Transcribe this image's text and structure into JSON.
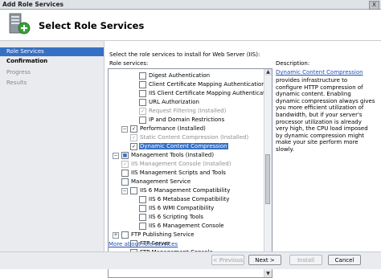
{
  "window": {
    "title": "Add Role Services",
    "close_glyph": "X"
  },
  "header": {
    "title": "Select Role Services"
  },
  "nav": [
    {
      "label": "Role Services",
      "state": "active"
    },
    {
      "label": "Confirmation",
      "state": "current"
    },
    {
      "label": "Progress",
      "state": "disabled"
    },
    {
      "label": "Results",
      "state": "disabled"
    }
  ],
  "instructions": "Select the role services to install for Web Server (IIS):",
  "role_services_label": "Role services:",
  "tree": [
    {
      "label": "Digest Authentication",
      "check": "",
      "style": "normal"
    },
    {
      "label": "Client Certificate Mapping Authentication",
      "check": "",
      "style": "normal"
    },
    {
      "label": "IIS Client Certificate Mapping Authentication",
      "check": "",
      "style": "normal"
    },
    {
      "label": "URL Authorization",
      "check": "",
      "style": "normal"
    },
    {
      "label": "Request Filtering  (Installed)",
      "check": "✓",
      "style": "gray"
    },
    {
      "label": "IP and Domain Restrictions",
      "check": "",
      "style": "normal"
    },
    {
      "label": "Performance  (Installed)",
      "check": "✓",
      "style": "normal"
    },
    {
      "label": "Static Content Compression  (Installed)",
      "check": "✓",
      "style": "gray"
    },
    {
      "label": "Dynamic Content Compression",
      "check": "✓",
      "style": "selected"
    },
    {
      "label": "Management Tools  (Installed)",
      "check": "■",
      "style": "normal"
    },
    {
      "label": "IIS Management Console  (Installed)",
      "check": "✓",
      "style": "gray"
    },
    {
      "label": "IIS Management Scripts and Tools",
      "check": "",
      "style": "normal"
    },
    {
      "label": "Management Service",
      "check": "",
      "style": "normal"
    },
    {
      "label": "IIS 6 Management Compatibility",
      "check": "",
      "style": "normal"
    },
    {
      "label": "IIS 6 Metabase Compatibility",
      "check": "",
      "style": "normal"
    },
    {
      "label": "IIS 6 WMI Compatibility",
      "check": "",
      "style": "normal"
    },
    {
      "label": "IIS 6 Scripting Tools",
      "check": "",
      "style": "normal"
    },
    {
      "label": "IIS 6 Management Console",
      "check": "",
      "style": "normal"
    },
    {
      "label": "FTP Publishing Service",
      "check": "",
      "style": "normal"
    },
    {
      "label": "FTP Server",
      "check": "",
      "style": "normal"
    },
    {
      "label": "FTP Management Console",
      "check": "",
      "style": "normal"
    }
  ],
  "expanders": {
    "collapse": "−",
    "expand": "+"
  },
  "scroll": {
    "up": "▲",
    "down": "▼"
  },
  "description": {
    "title": "Description:",
    "link": "Dynamic Content Compression",
    "body": "provides infrastructure to configure HTTP compression of dynamic content. Enabling dynamic compression always gives you more efficient utilization of bandwidth, but if your server's processor utilization is already very high, the CPU load imposed by dynamic compression might make your site perform more slowly."
  },
  "more_link": "More about role services",
  "buttons": {
    "previous": "< Previous",
    "next": "Next >",
    "install": "Install",
    "cancel": "Cancel"
  },
  "colors": {
    "accent": "#3670c4",
    "link": "#1f4fb4",
    "nav_bg": "#e9ebee"
  }
}
